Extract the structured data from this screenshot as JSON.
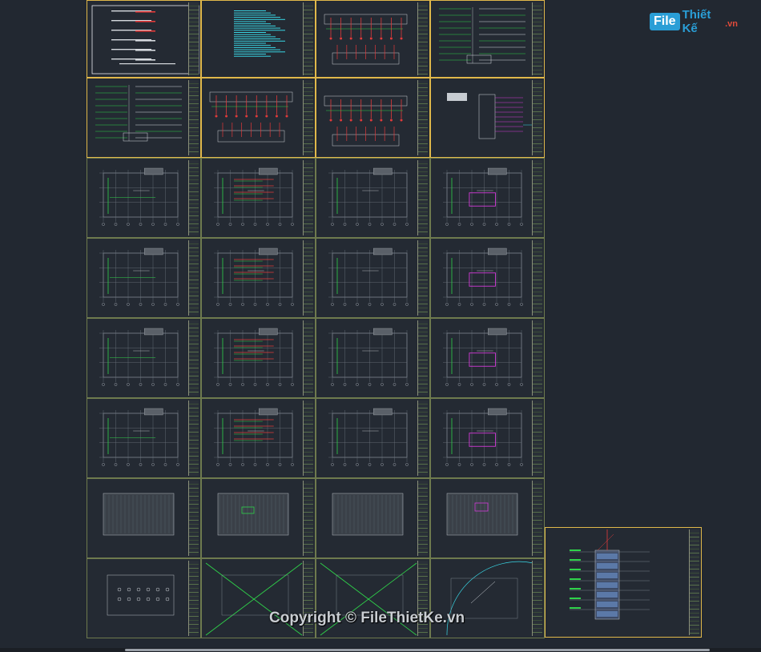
{
  "app": {
    "watermark_logo": {
      "box": "File",
      "rest": "Thiết Kế",
      "suffix": ".vn"
    },
    "copyright": "Copyright © FileThietKe.vn"
  },
  "colors": {
    "background": "#222831",
    "sheet_border": "#6e7a4e",
    "sheet_highlight": "#e0b84a",
    "red": "#e23a3a",
    "green": "#2fd24a",
    "magenta": "#d23ad6",
    "cyan": "#39d7e6",
    "white": "#e6e9ee"
  },
  "sheets": [
    {
      "kind": "cover"
    },
    {
      "kind": "notes"
    },
    {
      "kind": "riser-top"
    },
    {
      "kind": "schematic"
    },
    {
      "kind": "legend"
    },
    {
      "kind": "riser"
    },
    {
      "kind": "riser-tall"
    },
    {
      "kind": "panel"
    },
    {
      "kind": "plan-green"
    },
    {
      "kind": "plan-red"
    },
    {
      "kind": "plan-plain"
    },
    {
      "kind": "plan-magenta"
    },
    {
      "kind": "plan-green"
    },
    {
      "kind": "plan-red"
    },
    {
      "kind": "plan-plain"
    },
    {
      "kind": "plan-magenta"
    },
    {
      "kind": "plan-green"
    },
    {
      "kind": "plan-red"
    },
    {
      "kind": "plan-plain"
    },
    {
      "kind": "plan-magenta"
    },
    {
      "kind": "plan-green"
    },
    {
      "kind": "plan-red"
    },
    {
      "kind": "plan-plain"
    },
    {
      "kind": "plan-magenta"
    },
    {
      "kind": "roof"
    },
    {
      "kind": "roof-green"
    },
    {
      "kind": "roof-plain"
    },
    {
      "kind": "roof-magenta"
    },
    {
      "kind": "site"
    },
    {
      "kind": "cross"
    },
    {
      "kind": "cross"
    },
    {
      "kind": "arc"
    },
    {
      "kind": "elevation"
    }
  ]
}
